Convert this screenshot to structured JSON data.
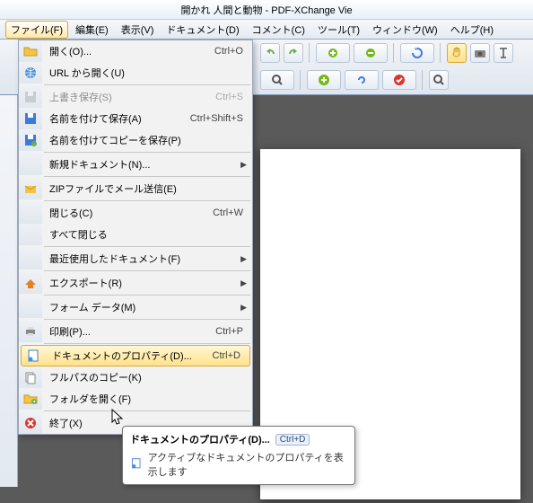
{
  "title": "開かれ 人間と動物 - PDF-XChange Vie",
  "menubar": {
    "file": "ファイル(F)",
    "edit": "編集(E)",
    "view": "表示(V)",
    "doc": "ドキュメント(D)",
    "comment": "コメント(C)",
    "tool": "ツール(T)",
    "window": "ウィンドウ(W)",
    "help": "ヘルプ(H)"
  },
  "file_menu": {
    "open": {
      "label": "開く(O)...",
      "shortcut": "Ctrl+O"
    },
    "open_url": {
      "label": "URL から開く(U)"
    },
    "save_over": {
      "label": "上書き保存(S)",
      "shortcut": "Ctrl+S"
    },
    "save_as": {
      "label": "名前を付けて保存(A)",
      "shortcut": "Ctrl+Shift+S"
    },
    "save_copy": {
      "label": "名前を付けてコピーを保存(P)"
    },
    "new_doc": {
      "label": "新規ドキュメント(N)..."
    },
    "zip_mail": {
      "label": "ZIPファイルでメール送信(E)"
    },
    "close": {
      "label": "閉じる(C)",
      "shortcut": "Ctrl+W"
    },
    "close_all": {
      "label": "すべて閉じる"
    },
    "recent": {
      "label": "最近使用したドキュメント(F)"
    },
    "export": {
      "label": "エクスポート(R)"
    },
    "form_data": {
      "label": "フォーム データ(M)"
    },
    "print": {
      "label": "印刷(P)...",
      "shortcut": "Ctrl+P"
    },
    "props": {
      "label": "ドキュメントのプロパティ(D)...",
      "shortcut": "Ctrl+D"
    },
    "copy_path": {
      "label": "フルパスのコピー(K)"
    },
    "open_folder": {
      "label": "フォルダを開く(F)"
    },
    "exit": {
      "label": "終了(X)"
    }
  },
  "tooltip": {
    "title": "ドキュメントのプロパティ(D)...",
    "shortcut": "Ctrl+D",
    "desc": "アクティブなドキュメントのプロパティを表示します"
  }
}
